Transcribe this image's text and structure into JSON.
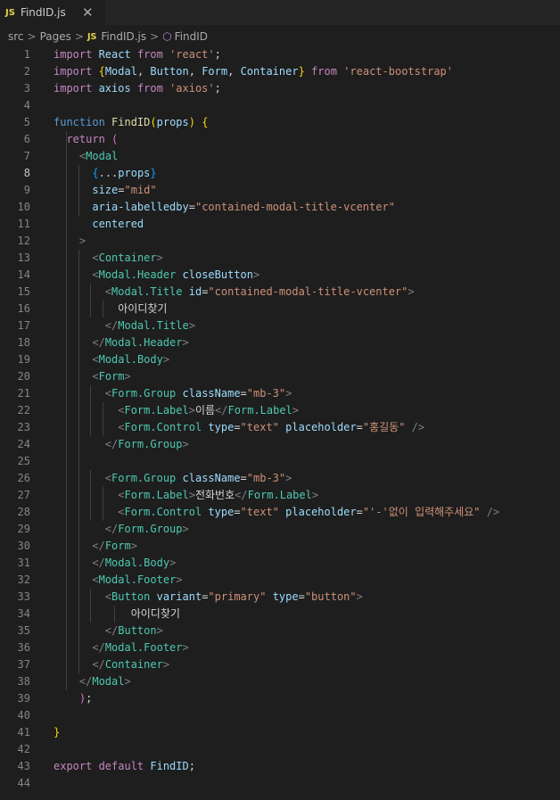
{
  "tab": {
    "icon": "JS",
    "title": "FindID.js",
    "close": "✕"
  },
  "breadcrumb": {
    "items": [
      "src",
      "Pages",
      "FindID.js",
      "FindID"
    ],
    "js_badge": "JS"
  },
  "active_line": 8,
  "lines": [
    [
      [
        "kw",
        "import "
      ],
      [
        "var",
        "React "
      ],
      [
        "kw",
        "from "
      ],
      [
        "str",
        "'react'"
      ],
      [
        "txt",
        ";"
      ]
    ],
    [
      [
        "kw",
        "import "
      ],
      [
        "brace1",
        "{"
      ],
      [
        "var",
        "Modal"
      ],
      [
        "txt",
        ", "
      ],
      [
        "var",
        "Button"
      ],
      [
        "txt",
        ", "
      ],
      [
        "var",
        "Form"
      ],
      [
        "txt",
        ", "
      ],
      [
        "var",
        "Container"
      ],
      [
        "brace1",
        "}"
      ],
      [
        "kw",
        " from "
      ],
      [
        "str",
        "'react-bootstrap'"
      ]
    ],
    [
      [
        "kw",
        "import "
      ],
      [
        "var",
        "axios "
      ],
      [
        "kw",
        "from "
      ],
      [
        "str",
        "'axios'"
      ],
      [
        "txt",
        ";"
      ]
    ],
    [],
    [
      [
        "kw2",
        "function "
      ],
      [
        "fn",
        "FindID"
      ],
      [
        "brace1",
        "("
      ],
      [
        "var",
        "props"
      ],
      [
        "brace1",
        ")"
      ],
      [
        "txt",
        " "
      ],
      [
        "brace1",
        "{"
      ]
    ],
    [
      [
        "txt",
        "  "
      ],
      [
        "kw",
        "return "
      ],
      [
        "brace2",
        "("
      ]
    ],
    [
      [
        "txt",
        "    "
      ],
      [
        "tag",
        "<"
      ],
      [
        "type",
        "Modal"
      ]
    ],
    [
      [
        "txt",
        "      "
      ],
      [
        "brace3",
        "{"
      ],
      [
        "txt",
        "..."
      ],
      [
        "var",
        "props"
      ],
      [
        "brace3",
        "}"
      ]
    ],
    [
      [
        "txt",
        "      "
      ],
      [
        "var",
        "size"
      ],
      [
        "txt",
        "="
      ],
      [
        "str",
        "\"mid\""
      ]
    ],
    [
      [
        "txt",
        "      "
      ],
      [
        "var",
        "aria-labelledby"
      ],
      [
        "txt",
        "="
      ],
      [
        "str",
        "\"contained-modal-title-vcenter\""
      ]
    ],
    [
      [
        "txt",
        "      "
      ],
      [
        "var",
        "centered"
      ]
    ],
    [
      [
        "txt",
        "    "
      ],
      [
        "tag",
        ">"
      ]
    ],
    [
      [
        "txt",
        "      "
      ],
      [
        "tag",
        "<"
      ],
      [
        "type",
        "Container"
      ],
      [
        "tag",
        ">"
      ]
    ],
    [
      [
        "txt",
        "      "
      ],
      [
        "tag",
        "<"
      ],
      [
        "type",
        "Modal.Header "
      ],
      [
        "var",
        "closeButton"
      ],
      [
        "tag",
        ">"
      ]
    ],
    [
      [
        "txt",
        "        "
      ],
      [
        "tag",
        "<"
      ],
      [
        "type",
        "Modal.Title "
      ],
      [
        "var",
        "id"
      ],
      [
        "txt",
        "="
      ],
      [
        "str",
        "\"contained-modal-title-vcenter\""
      ],
      [
        "tag",
        ">"
      ]
    ],
    [
      [
        "txt",
        "          아이디찾기"
      ]
    ],
    [
      [
        "txt",
        "        "
      ],
      [
        "tag",
        "</"
      ],
      [
        "type",
        "Modal.Title"
      ],
      [
        "tag",
        ">"
      ]
    ],
    [
      [
        "txt",
        "      "
      ],
      [
        "tag",
        "</"
      ],
      [
        "type",
        "Modal.Header"
      ],
      [
        "tag",
        ">"
      ]
    ],
    [
      [
        "txt",
        "      "
      ],
      [
        "tag",
        "<"
      ],
      [
        "type",
        "Modal.Body"
      ],
      [
        "tag",
        ">"
      ]
    ],
    [
      [
        "txt",
        "      "
      ],
      [
        "tag",
        "<"
      ],
      [
        "type",
        "Form"
      ],
      [
        "tag",
        ">"
      ]
    ],
    [
      [
        "txt",
        "        "
      ],
      [
        "tag",
        "<"
      ],
      [
        "type",
        "Form.Group "
      ],
      [
        "var",
        "className"
      ],
      [
        "txt",
        "="
      ],
      [
        "str",
        "\"mb-3\""
      ],
      [
        "tag",
        ">"
      ]
    ],
    [
      [
        "txt",
        "          "
      ],
      [
        "tag",
        "<"
      ],
      [
        "type",
        "Form.Label"
      ],
      [
        "tag",
        ">"
      ],
      [
        "txt",
        "이름"
      ],
      [
        "tag",
        "</"
      ],
      [
        "type",
        "Form.Label"
      ],
      [
        "tag",
        ">"
      ]
    ],
    [
      [
        "txt",
        "          "
      ],
      [
        "tag",
        "<"
      ],
      [
        "type",
        "Form.Control "
      ],
      [
        "var",
        "type"
      ],
      [
        "txt",
        "="
      ],
      [
        "str",
        "\"text\""
      ],
      [
        "txt",
        " "
      ],
      [
        "var",
        "placeholder"
      ],
      [
        "txt",
        "="
      ],
      [
        "str",
        "\"홍길동\""
      ],
      [
        "txt",
        " "
      ],
      [
        "tag",
        "/>"
      ]
    ],
    [
      [
        "txt",
        "        "
      ],
      [
        "tag",
        "</"
      ],
      [
        "type",
        "Form.Group"
      ],
      [
        "tag",
        ">"
      ]
    ],
    [],
    [
      [
        "txt",
        "        "
      ],
      [
        "tag",
        "<"
      ],
      [
        "type",
        "Form.Group "
      ],
      [
        "var",
        "className"
      ],
      [
        "txt",
        "="
      ],
      [
        "str",
        "\"mb-3\""
      ],
      [
        "tag",
        ">"
      ]
    ],
    [
      [
        "txt",
        "          "
      ],
      [
        "tag",
        "<"
      ],
      [
        "type",
        "Form.Label"
      ],
      [
        "tag",
        ">"
      ],
      [
        "txt",
        "전화번호"
      ],
      [
        "tag",
        "</"
      ],
      [
        "type",
        "Form.Label"
      ],
      [
        "tag",
        ">"
      ]
    ],
    [
      [
        "txt",
        "          "
      ],
      [
        "tag",
        "<"
      ],
      [
        "type",
        "Form.Control "
      ],
      [
        "var",
        "type"
      ],
      [
        "txt",
        "="
      ],
      [
        "str",
        "\"text\""
      ],
      [
        "txt",
        " "
      ],
      [
        "var",
        "placeholder"
      ],
      [
        "txt",
        "="
      ],
      [
        "str",
        "\"'-'없이 입력해주세요\""
      ],
      [
        "txt",
        " "
      ],
      [
        "tag",
        "/>"
      ]
    ],
    [
      [
        "txt",
        "        "
      ],
      [
        "tag",
        "</"
      ],
      [
        "type",
        "Form.Group"
      ],
      [
        "tag",
        ">"
      ]
    ],
    [
      [
        "txt",
        "      "
      ],
      [
        "tag",
        "</"
      ],
      [
        "type",
        "Form"
      ],
      [
        "tag",
        ">"
      ]
    ],
    [
      [
        "txt",
        "      "
      ],
      [
        "tag",
        "</"
      ],
      [
        "type",
        "Modal.Body"
      ],
      [
        "tag",
        ">"
      ]
    ],
    [
      [
        "txt",
        "      "
      ],
      [
        "tag",
        "<"
      ],
      [
        "type",
        "Modal.Footer"
      ],
      [
        "tag",
        ">"
      ]
    ],
    [
      [
        "txt",
        "        "
      ],
      [
        "tag",
        "<"
      ],
      [
        "type",
        "Button "
      ],
      [
        "var",
        "variant"
      ],
      [
        "txt",
        "="
      ],
      [
        "str",
        "\"primary\""
      ],
      [
        "txt",
        " "
      ],
      [
        "var",
        "type"
      ],
      [
        "txt",
        "="
      ],
      [
        "str",
        "\"button\""
      ],
      [
        "tag",
        ">"
      ]
    ],
    [
      [
        "txt",
        "            아이디찾기"
      ]
    ],
    [
      [
        "txt",
        "        "
      ],
      [
        "tag",
        "</"
      ],
      [
        "type",
        "Button"
      ],
      [
        "tag",
        ">"
      ]
    ],
    [
      [
        "txt",
        "      "
      ],
      [
        "tag",
        "</"
      ],
      [
        "type",
        "Modal.Footer"
      ],
      [
        "tag",
        ">"
      ]
    ],
    [
      [
        "txt",
        "      "
      ],
      [
        "tag",
        "</"
      ],
      [
        "type",
        "Container"
      ],
      [
        "tag",
        ">"
      ]
    ],
    [
      [
        "txt",
        "    "
      ],
      [
        "tag",
        "</"
      ],
      [
        "type",
        "Modal"
      ],
      [
        "tag",
        ">"
      ]
    ],
    [
      [
        "txt",
        "    "
      ],
      [
        "brace2",
        ")"
      ],
      [
        "txt",
        ";"
      ]
    ],
    [],
    [
      [
        "brace1",
        "}"
      ]
    ],
    [],
    [
      [
        "kw",
        "export "
      ],
      [
        "kw",
        "default "
      ],
      [
        "var",
        "FindID"
      ],
      [
        "txt",
        ";"
      ]
    ],
    []
  ]
}
